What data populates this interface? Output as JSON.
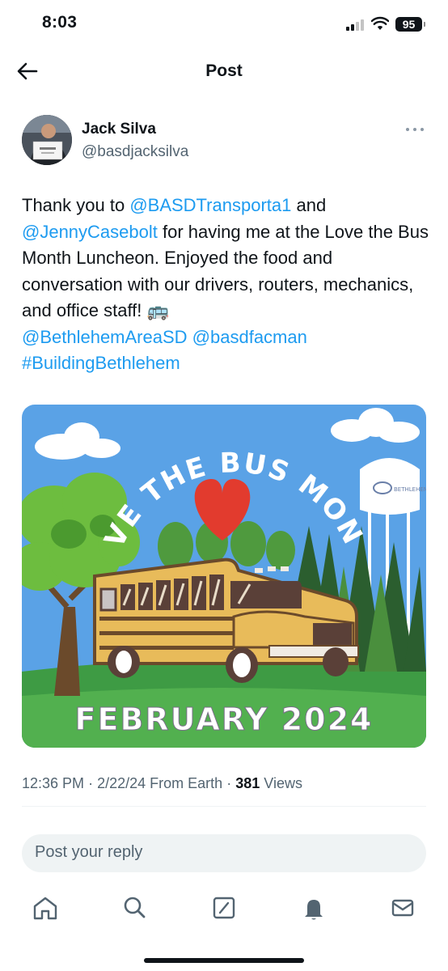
{
  "status_bar": {
    "time": "8:03",
    "battery": "95"
  },
  "header": {
    "title": "Post",
    "back_icon": "arrow-left-icon"
  },
  "author": {
    "name": "Jack Silva",
    "handle": "@basdjacksilva"
  },
  "post": {
    "text_parts": [
      {
        "type": "text",
        "value": "Thank you to "
      },
      {
        "type": "link",
        "value": "@BASDTransporta1"
      },
      {
        "type": "text",
        "value": " and "
      },
      {
        "type": "link",
        "value": "@JennyCasebolt"
      },
      {
        "type": "text",
        "value": " for having me at the Love the Bus Month Luncheon. Enjoyed the food and conversation with our drivers, routers, mechanics, and office staff! "
      },
      {
        "type": "emoji",
        "value": "🚌"
      },
      {
        "type": "link",
        "value": "@BethlehemAreaSD"
      },
      {
        "type": "text",
        "value": " "
      },
      {
        "type": "link",
        "value": "@basdfacman"
      },
      {
        "type": "text",
        "value": " "
      },
      {
        "type": "link",
        "value": "#BuildingBethlehem"
      }
    ],
    "image": {
      "arc_text": "LOVE THE BUS MONTH",
      "bottom_text": "FEBRUARY 2024",
      "tank_text": "BETHLEHEM"
    }
  },
  "meta": {
    "time": "12:36 PM",
    "separator": "·",
    "date": "2/22/24",
    "source": "From Earth",
    "views_count": "381",
    "views_label": "Views"
  },
  "reply": {
    "placeholder": "Post your reply"
  },
  "tabs": [
    {
      "icon": "home-icon"
    },
    {
      "icon": "search-icon"
    },
    {
      "icon": "compose-icon"
    },
    {
      "icon": "bell-icon"
    },
    {
      "icon": "mail-icon"
    }
  ],
  "colors": {
    "accent": "#1d9bf0",
    "text": "#0f1419",
    "secondary": "#536471",
    "input_bg": "#eff3f4"
  }
}
